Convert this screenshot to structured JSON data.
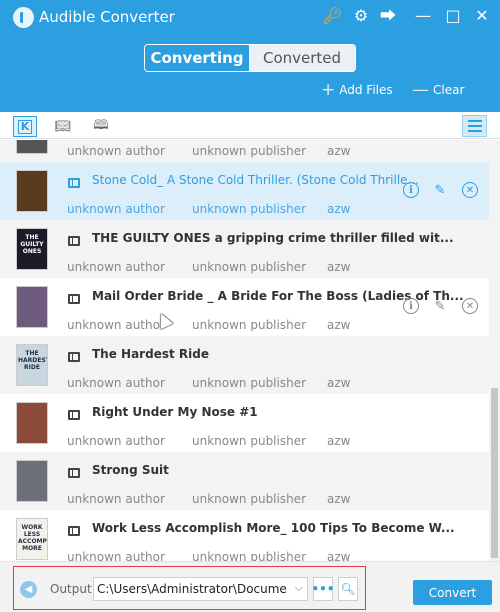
{
  "app": {
    "title": "Audible Converter",
    "icons": {
      "key": "key-icon",
      "settings": "gear-icon",
      "share": "share-icon",
      "minimize": "minimize-icon",
      "maximize": "maximize-icon",
      "close": "close-icon"
    }
  },
  "tabs": {
    "converting": "Converting",
    "converted": "Converted",
    "active": "Converting"
  },
  "actions": {
    "add_files": "Add Files",
    "clear": "Clear"
  },
  "toolbar": {
    "k_label": "K"
  },
  "colors": {
    "accent": "#2c9fe0",
    "selected_row": "#ddeefb",
    "highlight_border": "#e04040"
  },
  "books": [
    {
      "title": "",
      "author": "unknown author",
      "publisher": "unknown publisher",
      "format": "azw",
      "cover_color": "#555555",
      "cover_text": ""
    },
    {
      "title": "Stone Cold_ A Stone Cold Thriller. (Stone Cold Thrille...",
      "author": "unknown author",
      "publisher": "unknown publisher",
      "format": "azw",
      "cover_color": "#5a3b1e",
      "cover_text": "",
      "selected": true
    },
    {
      "title": "THE GUILTY ONES a gripping crime thriller filled wit...",
      "author": "unknown author",
      "publisher": "unknown publisher",
      "format": "azw",
      "cover_color": "#1b1b2a",
      "cover_text": "THE GUILTY ONES"
    },
    {
      "title": "Mail Order Bride _ A Bride For The Boss (Ladies of Th...",
      "author": "unknown author",
      "publisher": "unknown publisher",
      "format": "azw",
      "cover_color": "#6d5a7c",
      "cover_text": ""
    },
    {
      "title": "The Hardest Ride",
      "author": "unknown author",
      "publisher": "unknown publisher",
      "format": "azw",
      "cover_color": "#c8d6df",
      "cover_text": "THE HARDEST RIDE"
    },
    {
      "title": "Right Under My Nose #1",
      "author": "unknown author",
      "publisher": "unknown publisher",
      "format": "azw",
      "cover_color": "#8a4b3a",
      "cover_text": ""
    },
    {
      "title": "Strong Suit",
      "author": "unknown author",
      "publisher": "unknown publisher",
      "format": "azw",
      "cover_color": "#6b6f78",
      "cover_text": ""
    },
    {
      "title": "Work Less Accomplish More_ 100 Tips To Become W...",
      "author": "unknown author",
      "publisher": "unknown publisher",
      "format": "azw",
      "cover_color": "#f4f1ea",
      "cover_text": "WORK LESS ACCOMPLISH MORE"
    }
  ],
  "footer": {
    "output_label": "Output",
    "output_path": "C:\\Users\\Administrator\\Documents\\l",
    "browse_label": "•••",
    "convert_label": "Convert"
  }
}
